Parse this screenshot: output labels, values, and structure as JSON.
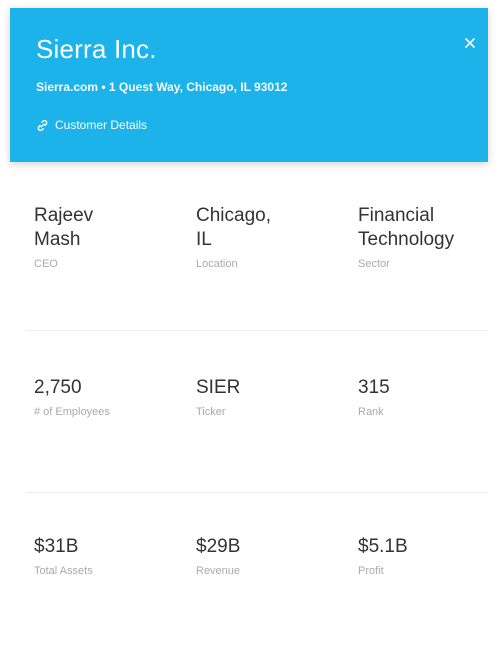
{
  "header": {
    "company": "Sierra Inc.",
    "address": "Sierra.com • 1 Quest Way, Chicago, IL 93012",
    "details_link": "Customer Details",
    "link_icon": "link-icon",
    "close_icon": "close-icon"
  },
  "stats": {
    "ceo": {
      "value": "Rajeev\nMash",
      "label": "CEO"
    },
    "location": {
      "value": "Chicago,\nIL",
      "label": "Location"
    },
    "sector": {
      "value": "Financial\nTechnology",
      "label": "Sector"
    },
    "employees": {
      "value": "2,750",
      "label": "# of Employees"
    },
    "ticker": {
      "value": "SIER",
      "label": "Ticker"
    },
    "rank": {
      "value": "315",
      "label": "Rank"
    },
    "assets": {
      "value": "$31B",
      "label": "Total Assets"
    },
    "revenue": {
      "value": "$29B",
      "label": "Revenue"
    },
    "profit": {
      "value": "$5.1B",
      "label": "Profit"
    }
  },
  "colors": {
    "header_bg": "#1cb3ea",
    "value_text": "#333333",
    "label_text": "#aaaaaa"
  }
}
